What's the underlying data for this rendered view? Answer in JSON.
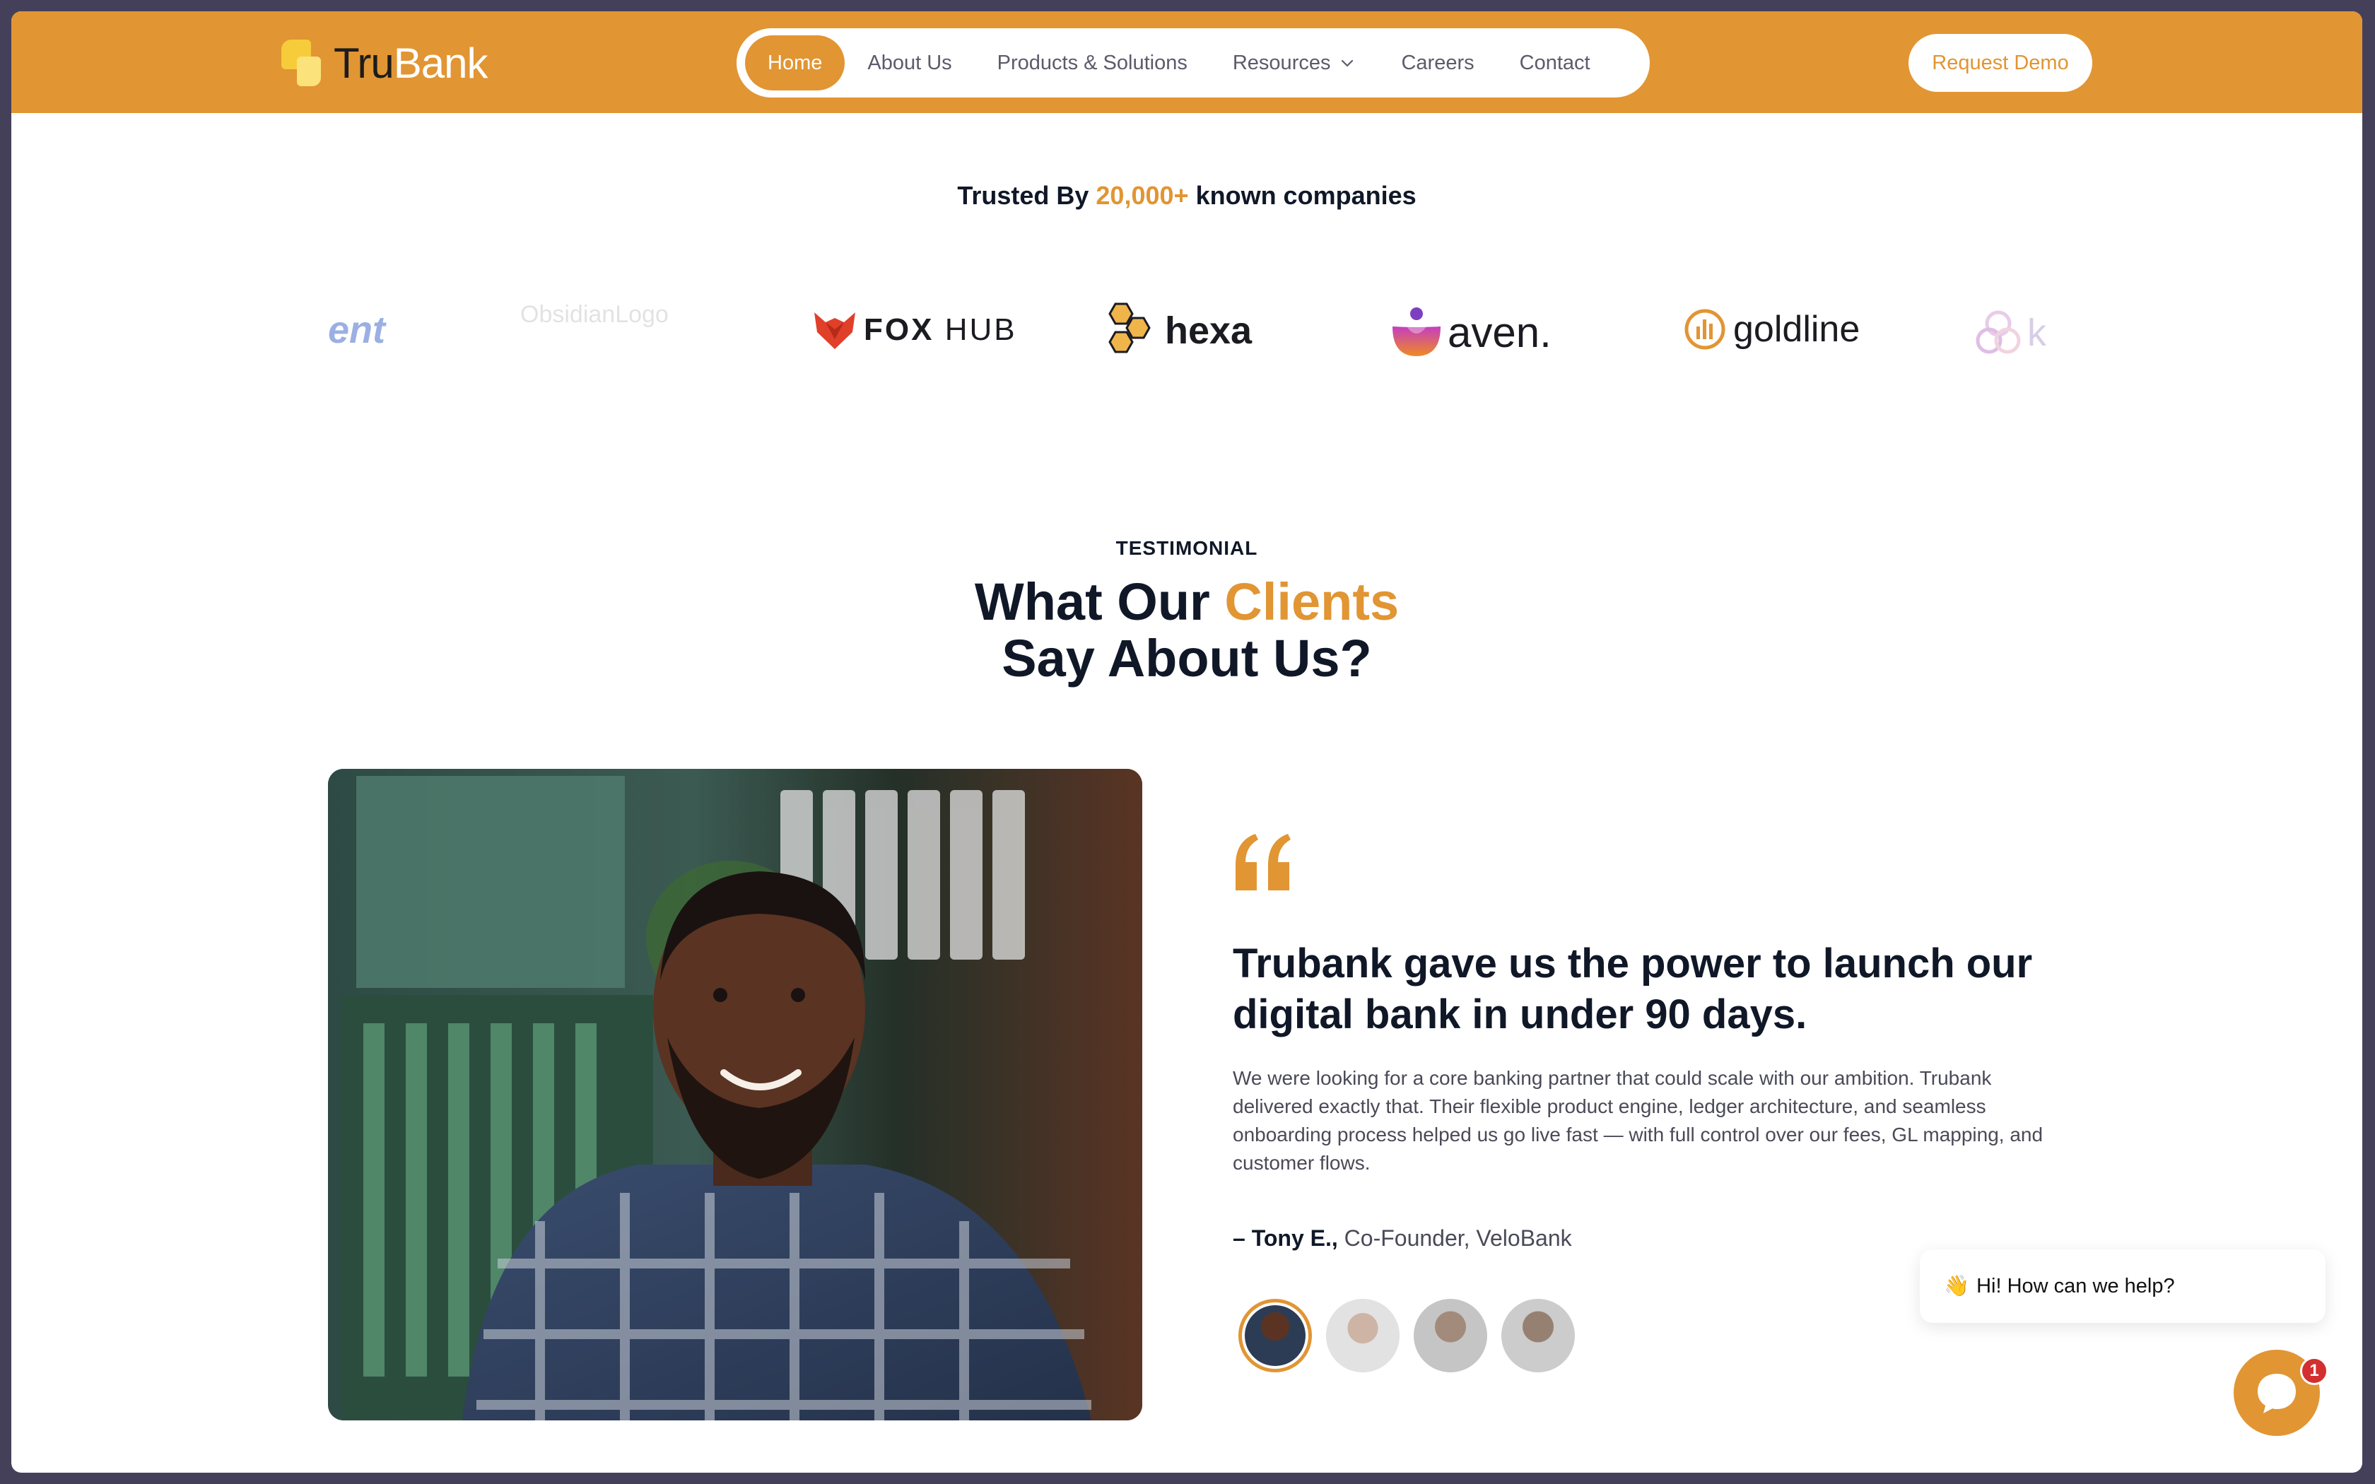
{
  "header": {
    "logo": {
      "part1": "Tru",
      "part2": "Bank"
    },
    "nav": [
      {
        "label": "Home",
        "active": true
      },
      {
        "label": "About Us"
      },
      {
        "label": "Products & Solutions"
      },
      {
        "label": "Resources",
        "dropdown": true
      },
      {
        "label": "Careers"
      },
      {
        "label": "Contact"
      }
    ],
    "cta": "Request Demo"
  },
  "trusted": {
    "prefix": "Trusted By",
    "highlight": "20,000+",
    "suffix": "known companies"
  },
  "brands": [
    {
      "label": "ent",
      "icon": "partial-logo"
    },
    {
      "label": "ObsidianLogo",
      "icon": "faded-logo"
    },
    {
      "label_bold": "FOX",
      "label_thin": "HUB",
      "icon": "fox-icon"
    },
    {
      "label": "hexa",
      "icon": "hexagon-icon"
    },
    {
      "label": "aven.",
      "icon": "lotus-icon"
    },
    {
      "label": "goldline",
      "icon": "bars-circle-icon"
    },
    {
      "label": "k",
      "icon": "rings-icon"
    }
  ],
  "testimonial": {
    "eyebrow": "TESTIMONIAL",
    "title_1": "What Our",
    "title_hl": "Clients",
    "title_2": "Say About Us?",
    "headline": "Trubank gave us the power to launch our digital bank in under 90 days.",
    "body": "We were looking for a core banking partner that could scale with our ambition. Trubank delivered exactly that. Their flexible product engine, ledger architecture, and seamless onboarding process helped us go live fast — with full control over our fees, GL mapping, and customer flows.",
    "author_name": "– Tony E.,",
    "author_role": "Co-Founder, VeloBank",
    "avatars": 4,
    "active_avatar": 0
  },
  "chat": {
    "emoji": "👋",
    "greeting": "Hi! How can we help?",
    "badge": "1"
  },
  "colors": {
    "accent": "#e19533",
    "text": "#101828",
    "badge": "#d32f2f"
  }
}
